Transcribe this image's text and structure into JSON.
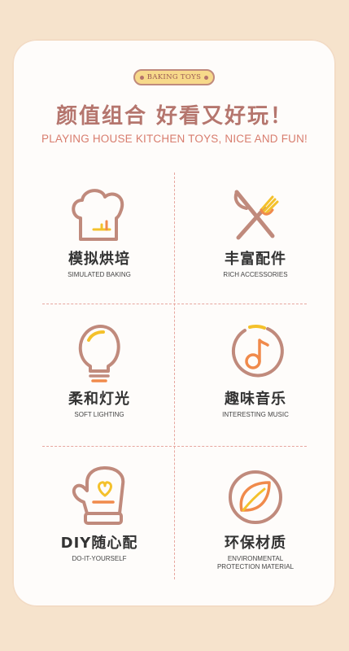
{
  "badge": "BAKING TOYS",
  "title_cn": "颜值组合 好看又好玩！",
  "title_en": "PLAYING HOUSE KITCHEN TOYS, NICE AND FUN!",
  "features": [
    {
      "icon": "chef-hat-icon",
      "cn": "模拟烘培",
      "en": "SIMULATED BAKING"
    },
    {
      "icon": "fork-knife-icon",
      "cn": "丰富配件",
      "en": "RICH ACCESSORIES"
    },
    {
      "icon": "light-bulb-icon",
      "cn": "柔和灯光",
      "en": "SOFT LIGHTING"
    },
    {
      "icon": "music-note-icon",
      "cn": "趣味音乐",
      "en": "INTERESTING MUSIC"
    },
    {
      "icon": "oven-mitt-icon",
      "cn": "DIY随心配",
      "en": "DO-IT-YOURSELF"
    },
    {
      "icon": "leaf-icon",
      "cn": "环保材质",
      "en": "ENVIRONMENTAL\nPROTECTION MATERIAL"
    }
  ],
  "colors": {
    "accent": "#b5766e",
    "yellow": "#f4c12b",
    "orange": "#f08a4b",
    "outline": "#c08a7c"
  }
}
